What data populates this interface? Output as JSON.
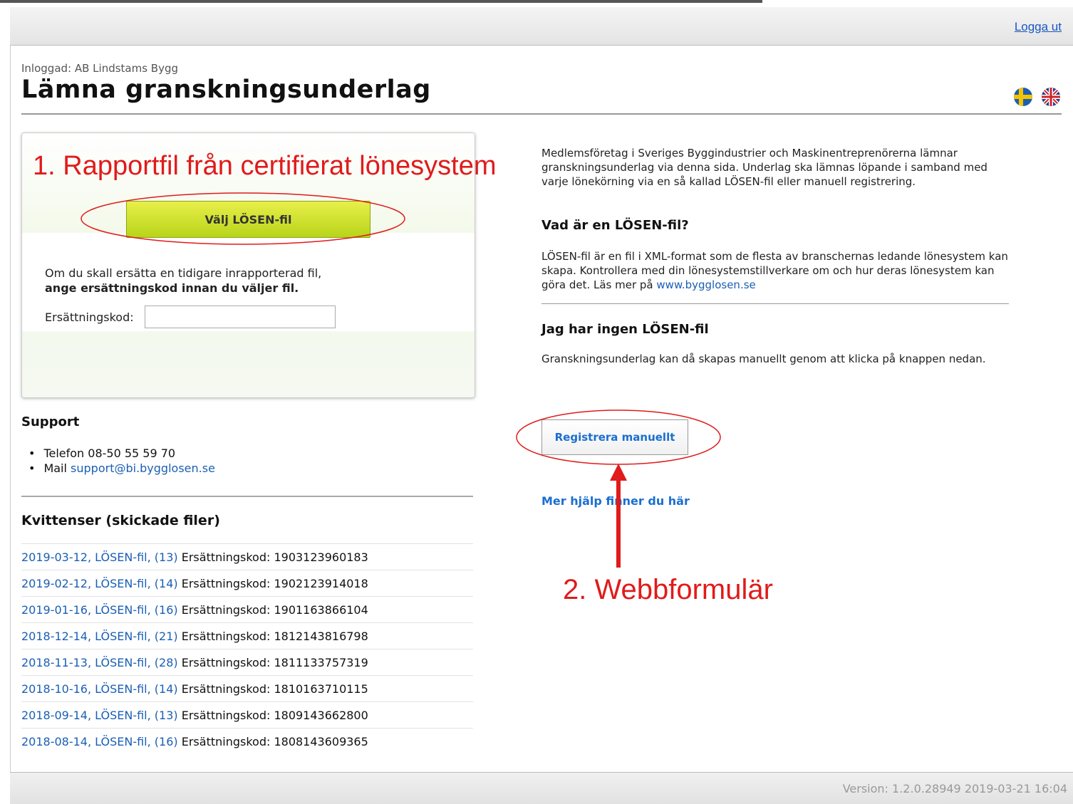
{
  "header": {
    "logout_label": "Logga ut"
  },
  "page": {
    "logged_in_text": "Inloggad: AB Lindstams Bygg",
    "title": "Lämna granskningsunderlag"
  },
  "upload_panel": {
    "choose_button_label": "Välj LÖSEN-fil",
    "replace_text_line1": "Om du skall ersätta en tidigare inrapporterad fil,",
    "replace_text_bold": "ange ersättningskod innan du väljer fil.",
    "code_label": "Ersättningskod:",
    "code_value": ""
  },
  "support": {
    "heading": "Support",
    "phone_text": "Telefon 08-50 55 59 70",
    "mail_prefix": "Mail",
    "mail_link": "support@bi.bygglosen.se"
  },
  "receipts": {
    "heading": "Kvittenser (skickade filer)",
    "code_label": "Ersättningskod:",
    "items": [
      {
        "link": "2019-03-12, LÖSEN-fil, (13)",
        "code": "1903123960183"
      },
      {
        "link": "2019-02-12, LÖSEN-fil, (14)",
        "code": "1902123914018"
      },
      {
        "link": "2019-01-16, LÖSEN-fil, (16)",
        "code": "1901163866104"
      },
      {
        "link": "2018-12-14, LÖSEN-fil, (21)",
        "code": "1812143816798"
      },
      {
        "link": "2018-11-13, LÖSEN-fil, (28)",
        "code": "1811133757319"
      },
      {
        "link": "2018-10-16, LÖSEN-fil, (14)",
        "code": "1810163710115"
      },
      {
        "link": "2018-09-14, LÖSEN-fil, (13)",
        "code": "1809143662800"
      },
      {
        "link": "2018-08-14, LÖSEN-fil, (16)",
        "code": "1808143609365"
      }
    ]
  },
  "info": {
    "intro": "Medlemsföretag i Sveriges Byggindustrier och Maskinentreprenörerna lämnar granskningsunderlag via denna sida. Underlag ska lämnas löpande i samband med varje lönekörning via en så kallad LÖSEN-fil eller manuell registrering.",
    "what_heading": "Vad är en LÖSEN-fil?",
    "what_text": "LÖSEN-fil är en fil i XML-format som de flesta av branschernas ledande lönesystem kan skapa. Kontrollera med din lönesystemstillverkare om och hur deras lönesystem kan göra det. Läs mer på",
    "what_link": "www.bygglosen.se",
    "none_heading": "Jag har ingen LÖSEN-fil",
    "none_text": "Granskningsunderlag kan då skapas manuellt genom att klicka på knappen nedan.",
    "manual_button_label": "Registrera manuellt",
    "help_link": "Mer hjälp finner du här"
  },
  "annotations": {
    "label1": "1. Rapportfil från certifierat lönesystem",
    "label2": "2. Webbformulär",
    "color": "#e01b1b"
  },
  "footer": {
    "version": "Version: 1.2.0.28949 2019-03-21 16:04"
  },
  "icons": [
    "swedish-flag-icon",
    "uk-flag-icon"
  ]
}
